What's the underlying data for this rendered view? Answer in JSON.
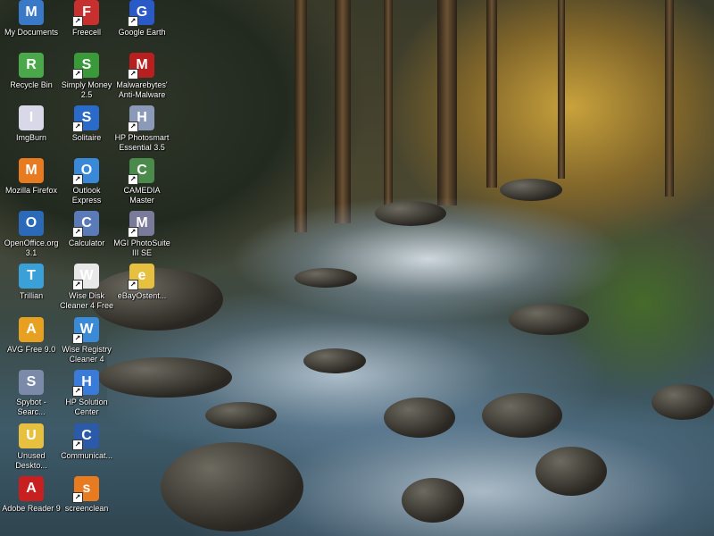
{
  "desktop": {
    "icons": [
      {
        "label": "My Documents",
        "icon": "folder-documents-icon",
        "color": "#3a78c8"
      },
      {
        "label": "Recycle Bin",
        "icon": "recycle-bin-icon",
        "color": "#4aa84a"
      },
      {
        "label": "ImgBurn",
        "icon": "disc-icon",
        "color": "#d8d8e8"
      },
      {
        "label": "Mozilla Firefox",
        "icon": "firefox-icon",
        "color": "#e87a20"
      },
      {
        "label": "OpenOffice.org 3.1",
        "icon": "openoffice-icon",
        "color": "#2a6ab8"
      },
      {
        "label": "Trillian",
        "icon": "trillian-icon",
        "color": "#3aa0d8"
      },
      {
        "label": "AVG Free 9.0",
        "icon": "avg-icon",
        "color": "#e8a020"
      },
      {
        "label": "Spybot - Searc...",
        "icon": "spybot-icon",
        "color": "#7a8aa8"
      },
      {
        "label": "Unused Deskto...",
        "icon": "folder-icon",
        "color": "#e8c040"
      },
      {
        "label": "Adobe Reader 9",
        "icon": "adobe-reader-icon",
        "color": "#c82020"
      },
      {
        "label": "Freecell",
        "icon": "freecell-icon",
        "color": "#c83030"
      },
      {
        "label": "Simply Money 2.5",
        "icon": "simply-money-icon",
        "color": "#3a9a3a"
      },
      {
        "label": "Solitaire",
        "icon": "solitaire-icon",
        "color": "#2a6ac8"
      },
      {
        "label": "Outlook Express",
        "icon": "outlook-express-icon",
        "color": "#3a88d8"
      },
      {
        "label": "Calculator",
        "icon": "calculator-icon",
        "color": "#5a7ab8"
      },
      {
        "label": "Wise Disk Cleaner 4 Free",
        "icon": "wise-disk-cleaner-icon",
        "color": "#e8e8e8"
      },
      {
        "label": "Wise Registry Cleaner 4",
        "icon": "wise-registry-cleaner-icon",
        "color": "#3a8ad8"
      },
      {
        "label": "HP Solution Center",
        "icon": "hp-solution-center-icon",
        "color": "#3a7ad8"
      },
      {
        "label": "Communicat...",
        "icon": "communicator-icon",
        "color": "#2a5aa8"
      },
      {
        "label": "screenclean",
        "icon": "screenclean-icon",
        "color": "#e87a20"
      },
      {
        "label": "Google Earth",
        "icon": "google-earth-icon",
        "color": "#2a5ac8"
      },
      {
        "label": "Malwarebytes' Anti-Malware",
        "icon": "malwarebytes-icon",
        "color": "#b82020"
      },
      {
        "label": "HP Photosmart Essential 3.5",
        "icon": "hp-photosmart-icon",
        "color": "#8a9ab8"
      },
      {
        "label": "CAMEDIA Master",
        "icon": "camedia-icon",
        "color": "#4a8a4a"
      },
      {
        "label": "MGI PhotoSuite III SE",
        "icon": "mgi-photosuite-icon",
        "color": "#7a7a9a"
      },
      {
        "label": "eBayOstent...",
        "icon": "folder-icon",
        "color": "#e8c040"
      }
    ]
  }
}
